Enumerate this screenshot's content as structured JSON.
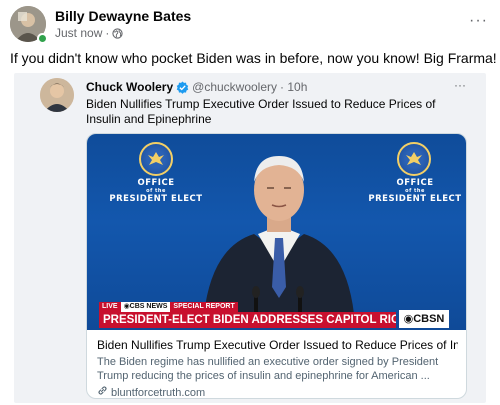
{
  "post": {
    "author": "Billy Dewayne Bates",
    "time": "Just now",
    "separator": "·",
    "more": "···",
    "text": "If you didn't know who pocket Biden was in before, now you know! Big Frarma!"
  },
  "tweet": {
    "name": "Chuck Woolery",
    "handle": "@chuckwoolery",
    "time": "· 10h",
    "more": "···",
    "text": "Biden Nullifies Trump Executive Order Issued to Reduce Prices of Insulin and Epinephrine"
  },
  "card": {
    "overlay": {
      "office_top": "OFFICE",
      "office_of": "of the",
      "office_bottom": "PRESIDENT ELECT",
      "live": "LIVE",
      "network": "◉CBS NEWS",
      "special": "SPECIAL REPORT",
      "headline": "PRESIDENT-ELECT BIDEN ADDRESSES CAPITOL RIOTS",
      "channel": "◉CBSN"
    },
    "title": "Biden Nullifies Trump Executive Order Issued to Reduce Prices of Insulin...",
    "description": "The Biden regime has nullified an executive order signed by President Trump reducing the prices of insulin and epinephrine for American ...",
    "link": "bluntforcetruth.com"
  },
  "colors": {
    "verified": "#1d9bf0",
    "online": "#31a24c",
    "cbs_red": "#c8102e",
    "backdrop_blue": "#1357ad"
  }
}
